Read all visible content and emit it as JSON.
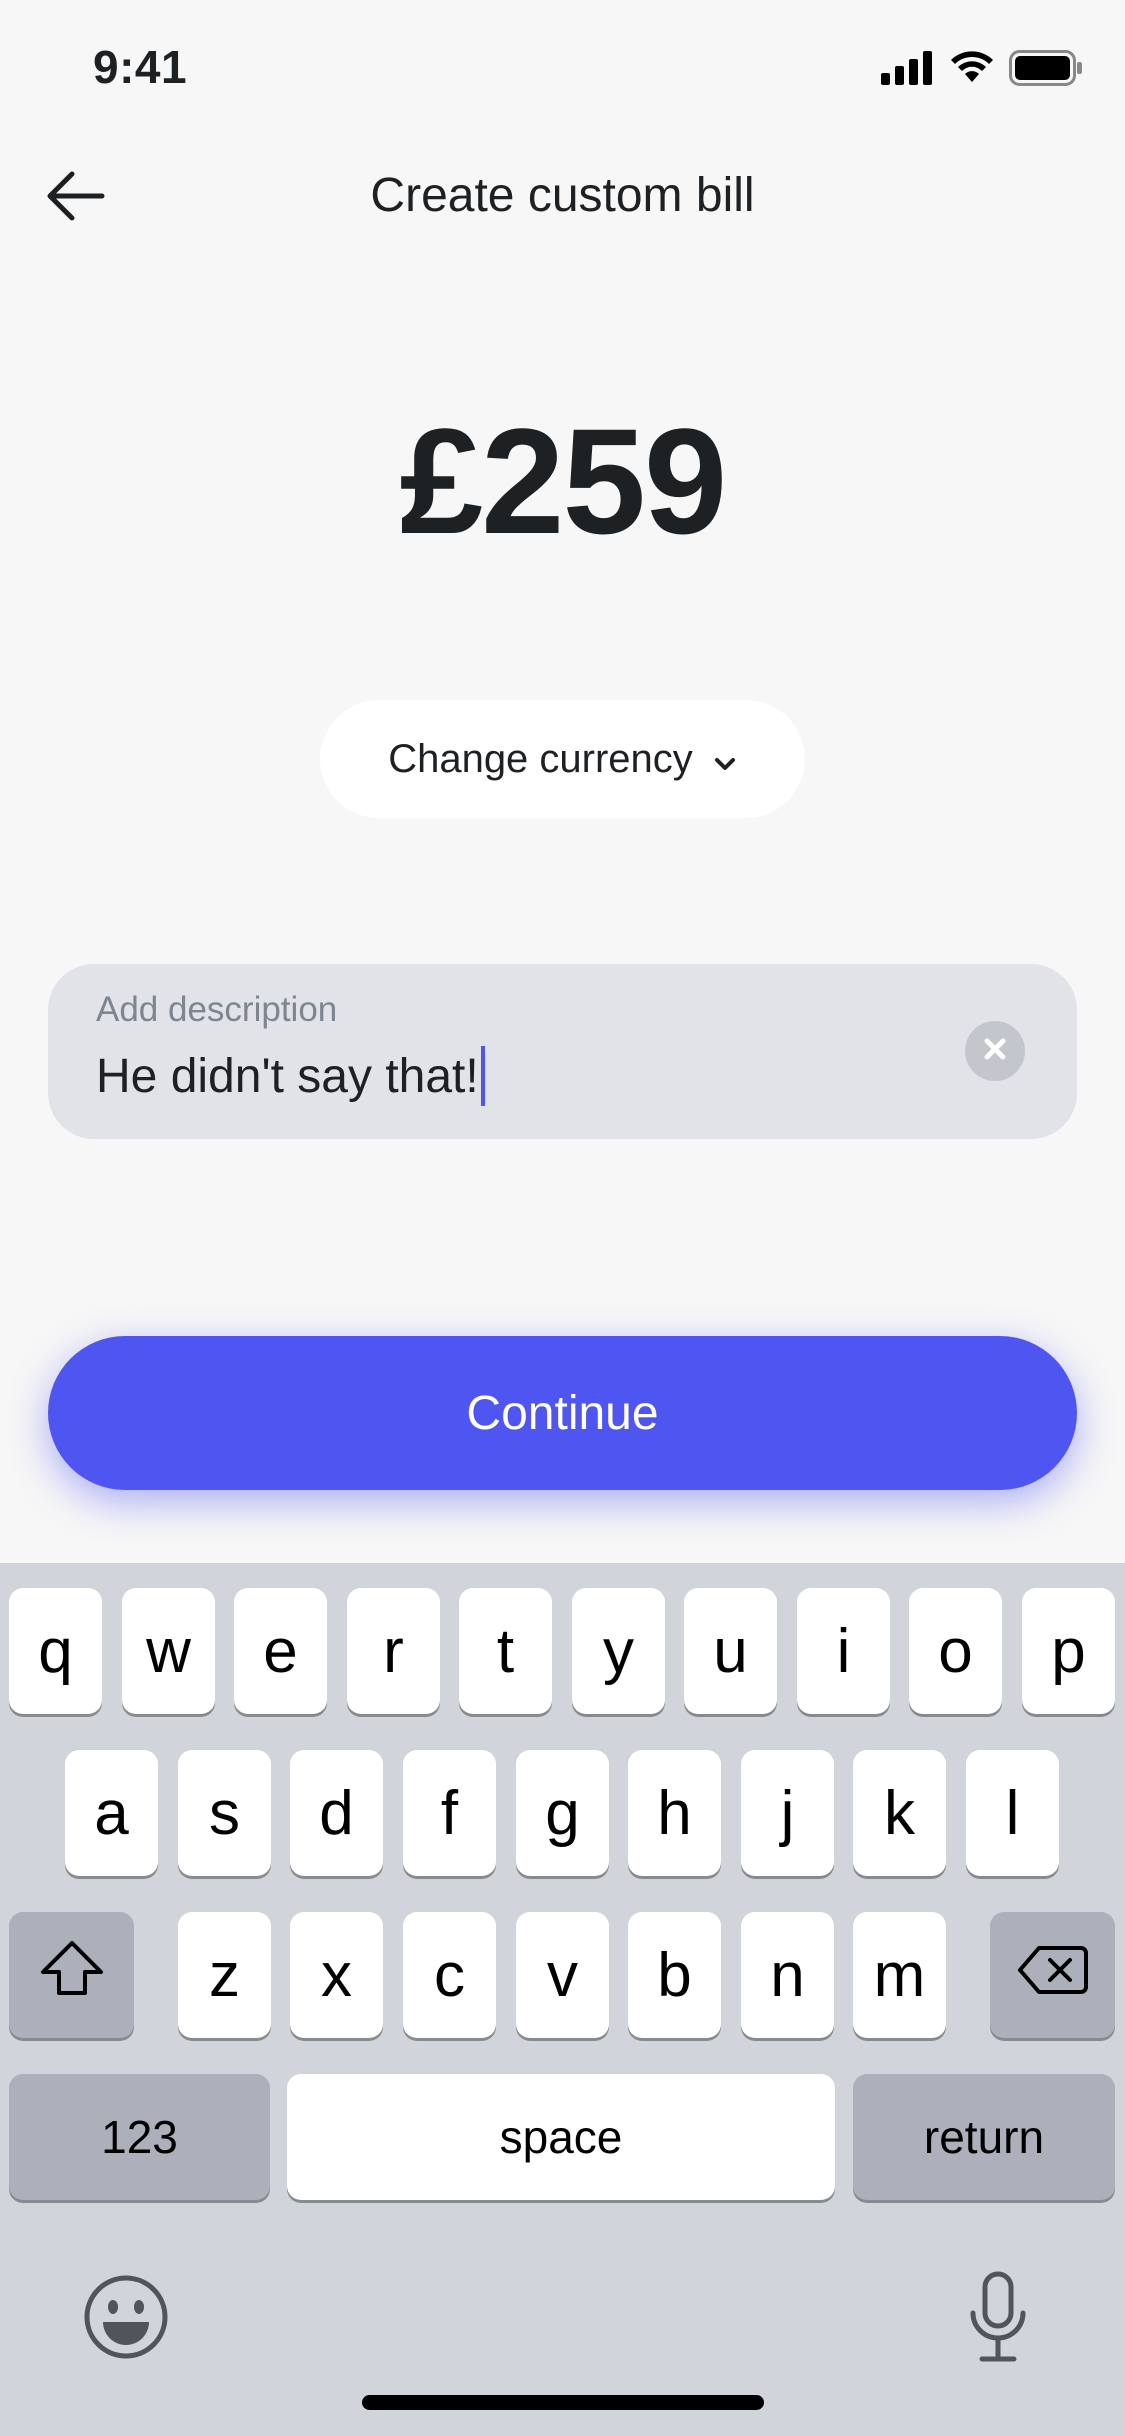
{
  "status_bar": {
    "time": "9:41",
    "icons": [
      "signal-icon",
      "wifi-icon",
      "battery-icon"
    ]
  },
  "header": {
    "title": "Create custom bill",
    "back_icon": "arrow-left-icon"
  },
  "amount": {
    "value": "£259"
  },
  "currency_button": {
    "label": "Change currency",
    "icon": "chevron-down-icon"
  },
  "description": {
    "label": "Add description",
    "value": "He didn't say that!",
    "clear_icon": "clear-icon"
  },
  "continue_button": {
    "label": "Continue"
  },
  "keyboard": {
    "row1": [
      "q",
      "w",
      "e",
      "r",
      "t",
      "y",
      "u",
      "i",
      "o",
      "p"
    ],
    "row2": [
      "a",
      "s",
      "d",
      "f",
      "g",
      "h",
      "j",
      "k",
      "l"
    ],
    "row3": [
      "z",
      "x",
      "c",
      "v",
      "b",
      "n",
      "m"
    ],
    "numbers_label": "123",
    "space_label": "space",
    "return_label": "return",
    "icons": [
      "shift-icon",
      "delete-icon",
      "emoji-icon",
      "microphone-icon"
    ]
  },
  "colors": {
    "accent": "#4e55f1",
    "background": "#f7f7f7",
    "field_background": "#e1e3e8",
    "keyboard_background": "#d1d4db",
    "text": "#1e2124"
  }
}
